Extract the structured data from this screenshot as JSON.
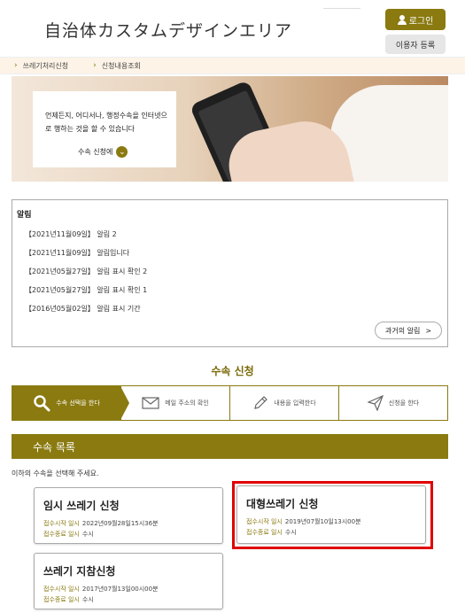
{
  "header": {
    "site_title": "自治体カスタムデザインエリア",
    "login_label": "로그인",
    "register_label": "이용자 등록"
  },
  "nav": {
    "items": [
      {
        "label": "쓰레기처리신청"
      },
      {
        "label": "신청내용조회"
      }
    ]
  },
  "hero": {
    "text": "언제든지, 어디서나, 행정수속을 인터넷으로 행하는 것을 할 수 있습니다",
    "link_label": "수속 신청에"
  },
  "notices": {
    "title": "알림",
    "items": [
      {
        "text": "【2021년11월09일】 알림 2"
      },
      {
        "text": "【2021년11월09일】 알림입니다"
      },
      {
        "text": "【2021년05월27일】 알림 표시 확인 2"
      },
      {
        "text": "【2021년05월27일】 알림 표시 확인 1"
      },
      {
        "text": "【2016년05월02일】 알림 표시 기간"
      }
    ],
    "past_label": "과거의 알림"
  },
  "procedure": {
    "heading": "수속 신청",
    "steps": [
      {
        "label": "수속 선택을 한다",
        "icon": "search-icon",
        "active": true
      },
      {
        "label": "메일 주소의 확인",
        "icon": "mail-icon",
        "active": false
      },
      {
        "label": "내용을 입력한다",
        "icon": "pencil-icon",
        "active": false
      },
      {
        "label": "신청을 한다",
        "icon": "send-icon",
        "active": false
      }
    ]
  },
  "list": {
    "header": "수속 목록",
    "instruction": "이하의 수속을 선택해 주세요.",
    "start_label": "접수시작 일시",
    "end_label": "접수종료 일시",
    "cards": [
      {
        "title": "임시 쓰레기 신청",
        "start": "2022년09월28일15시36분",
        "end": "수시"
      },
      {
        "title": "대형쓰레기 신청",
        "start": "2019년07월10일13시00분",
        "end": "수시"
      },
      {
        "title": "쓰레기 지참신청",
        "start": "2017년07월13일00시00분",
        "end": "수시"
      }
    ]
  },
  "colors": {
    "accent": "#8a7a10",
    "highlight": "#e00000",
    "nav_bg": "#fdf3e7"
  }
}
